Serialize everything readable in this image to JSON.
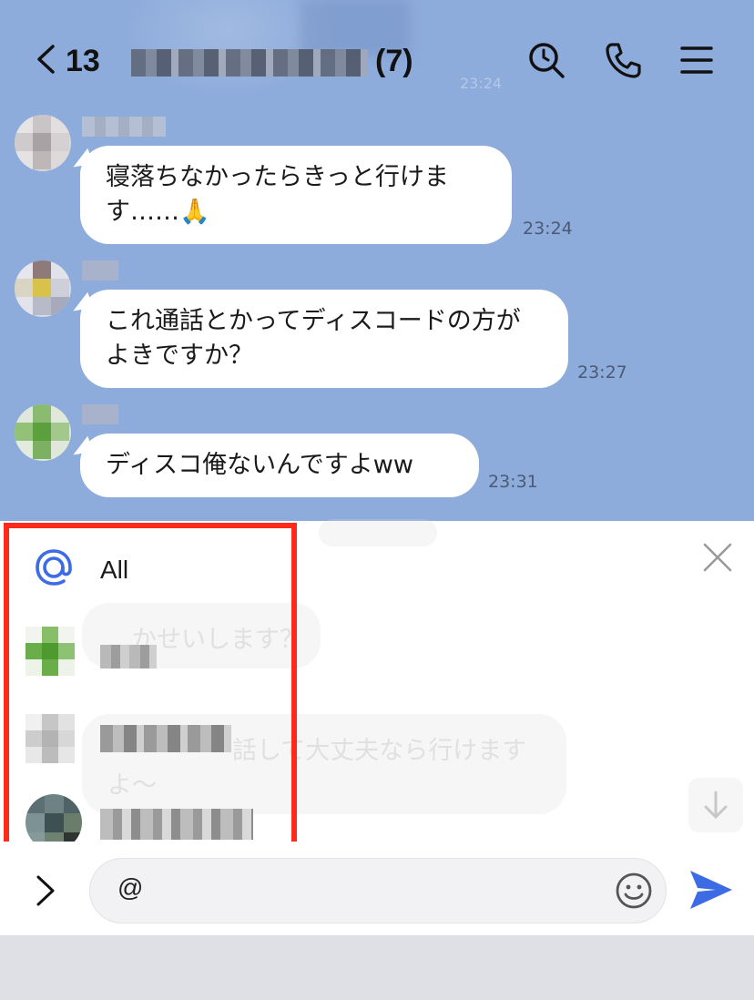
{
  "header": {
    "unread_count": "13",
    "member_count": "(7)",
    "faded_time": "23:24"
  },
  "messages": [
    {
      "text": "寝落ちなかったらきっと行けます……🙏",
      "time": "23:24"
    },
    {
      "text": "これ通話とかってディスコードの方がよきですか？",
      "time": "23:27"
    },
    {
      "text": "ディスコ俺ないんですよww",
      "time": "23:31"
    }
  ],
  "ghost": {
    "line1": "…かせいします？",
    "line2": "話して大丈夫なら行けます",
    "line3": "よ〜"
  },
  "mention": {
    "all_label": "All"
  },
  "input": {
    "value": "@"
  },
  "colors": {
    "chat_bg": "#8dabdb",
    "highlight": "#ff2a1a",
    "send": "#3d6be6",
    "mention_icon": "#3d6be6"
  }
}
